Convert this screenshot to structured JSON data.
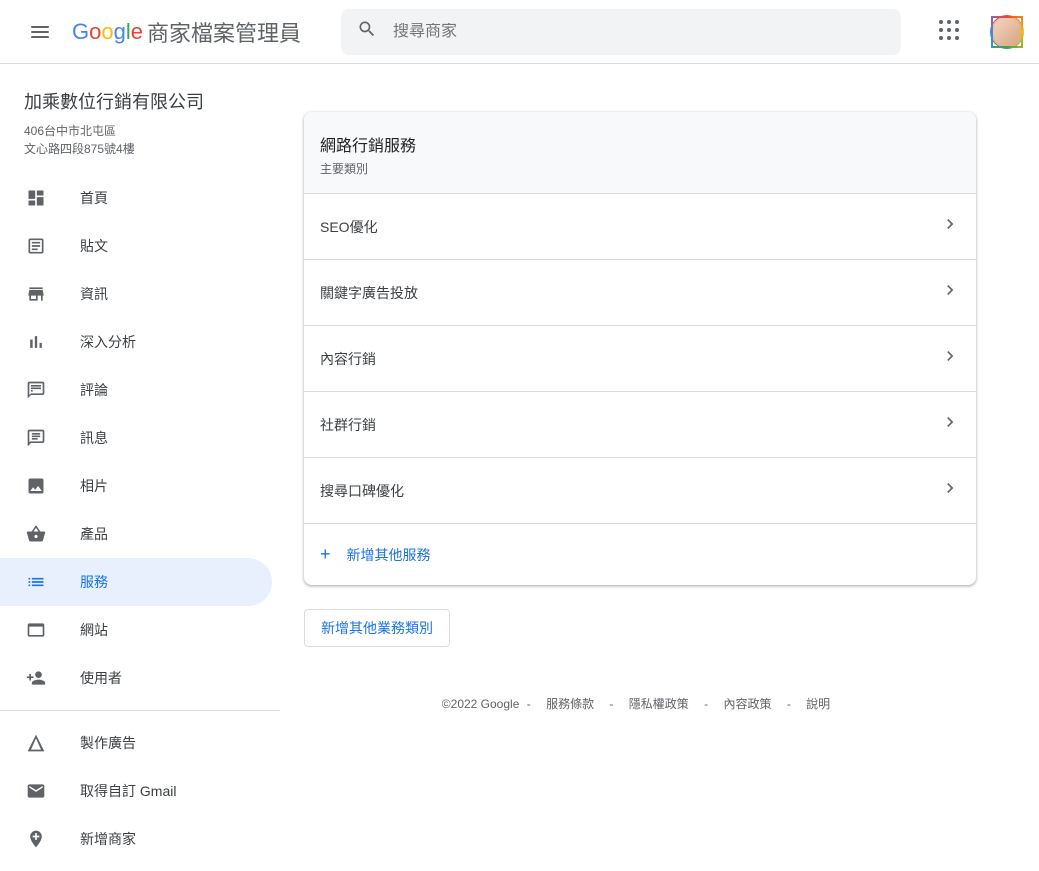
{
  "header": {
    "logo_text": "Google",
    "product_name": "商家檔案管理員",
    "search_placeholder": "搜尋商家"
  },
  "business": {
    "name": "加乘數位行銷有限公司",
    "addr_line1": "406台中市北屯區",
    "addr_line2": "文心路四段875號4樓"
  },
  "nav": {
    "items": [
      {
        "label": "首頁"
      },
      {
        "label": "貼文"
      },
      {
        "label": "資訊"
      },
      {
        "label": "深入分析"
      },
      {
        "label": "評論"
      },
      {
        "label": "訊息"
      },
      {
        "label": "相片"
      },
      {
        "label": "產品"
      },
      {
        "label": "服務"
      },
      {
        "label": "網站"
      },
      {
        "label": "使用者"
      }
    ],
    "secondary": [
      {
        "label": "製作廣告"
      },
      {
        "label": "取得自訂 Gmail"
      },
      {
        "label": "新增商家"
      }
    ]
  },
  "card": {
    "title": "網路行銷服務",
    "subtitle": "主要類別",
    "services": [
      {
        "label": "SEO優化"
      },
      {
        "label": "關鍵字廣告投放"
      },
      {
        "label": "內容行銷"
      },
      {
        "label": "社群行銷"
      },
      {
        "label": "搜尋口碑優化"
      }
    ],
    "add_service_label": "新增其他服務"
  },
  "add_category_btn": "新增其他業務類別",
  "footer": {
    "copyright": "©2022 Google",
    "links": [
      "服務條款",
      "隱私權政策",
      "內容政策",
      "說明"
    ]
  }
}
